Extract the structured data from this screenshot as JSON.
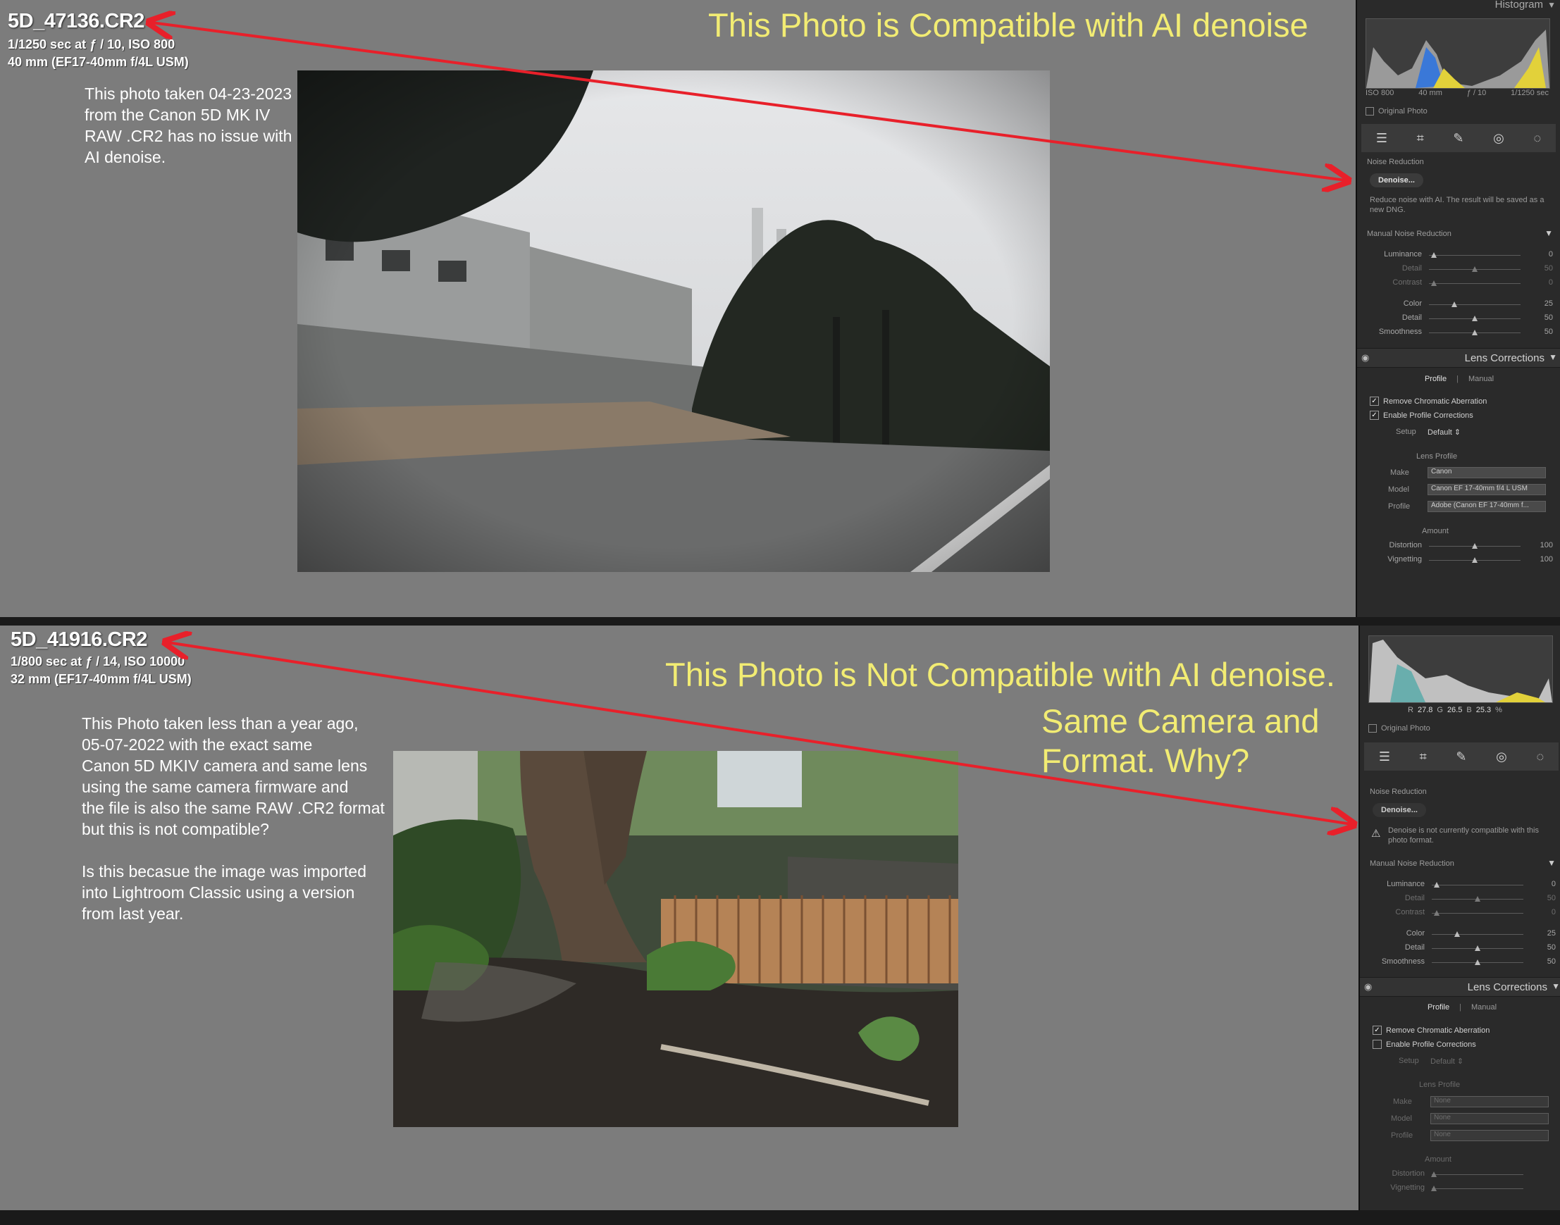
{
  "top": {
    "file_name": "5D_47136.CR2",
    "exposure": "1/1250 sec at ƒ / 10, ISO 800",
    "lens": "40 mm (EF17-40mm f/4L USM)",
    "note": "This photo taken 04-23-2023\nfrom the Canon 5D MK IV\nRAW .CR2 has no issue with\nAI denoise.",
    "headline": "This Photo is Compatible with AI denoise",
    "sidebar": {
      "histogram_label": "Histogram",
      "hist_info": [
        "ISO 800",
        "40 mm",
        "ƒ / 10",
        "1/1250 sec"
      ],
      "original_photo": "Original Photo",
      "noise_reduction": "Noise Reduction",
      "denoise_button": "Denoise...",
      "denoise_desc": "Reduce noise with AI. The result will be saved as a new DNG.",
      "manual_nr": "Manual Noise Reduction",
      "sliders": [
        {
          "label": "Luminance",
          "value": "0",
          "pos": 0.05,
          "dim": false
        },
        {
          "label": "Detail",
          "value": "50",
          "pos": 0.5,
          "dim": true
        },
        {
          "label": "Contrast",
          "value": "0",
          "pos": 0.05,
          "dim": true
        },
        {
          "label": "Color",
          "value": "25",
          "pos": 0.28,
          "dim": false
        },
        {
          "label": "Detail",
          "value": "50",
          "pos": 0.5,
          "dim": false
        },
        {
          "label": "Smoothness",
          "value": "50",
          "pos": 0.5,
          "dim": false
        }
      ],
      "lens_corrections": "Lens Corrections",
      "tab_profile": "Profile",
      "tab_manual": "Manual",
      "remove_ca": "Remove Chromatic Aberration",
      "enable_profile": "Enable Profile Corrections",
      "setup_label": "Setup",
      "setup_value": "Default",
      "lens_profile": "Lens Profile",
      "make_label": "Make",
      "make_value": "Canon",
      "model_label": "Model",
      "model_value": "Canon EF 17-40mm f/4 L USM",
      "profile_label": "Profile",
      "profile_value": "Adobe (Canon EF 17-40mm f...",
      "amount": "Amount",
      "distortion_label": "Distortion",
      "distortion_value": "100",
      "vignetting_label": "Vignetting",
      "vignetting_value": "100"
    }
  },
  "bottom": {
    "file_name": "5D_41916.CR2",
    "exposure": "1/800 sec at ƒ / 14, ISO 10000",
    "lens": "32 mm (EF17-40mm f/4L USM)",
    "note": "This Photo taken less than a year ago,\n05-07-2022 with the exact same\nCanon 5D MKIV camera and same lens\nusing the same camera firmware and\nthe file is also the same RAW .CR2 format\nbut this is not compatible?\n\nIs this becasue the image was imported\ninto Lightroom Classic using a version\nfrom last year.",
    "headline": "This Photo is Not Compatible with AI denoise.",
    "headline2": "Same Camera and\nFormat. Why?",
    "sidebar": {
      "rgb_r_label": "R",
      "rgb_r": "27.8",
      "rgb_g_label": "G",
      "rgb_g": "26.5",
      "rgb_b_label": "B",
      "rgb_b": "25.3",
      "rgb_unit": "%",
      "original_photo": "Original Photo",
      "noise_reduction": "Noise Reduction",
      "denoise_button": "Denoise...",
      "denoise_desc": "Denoise is not currently compatible with this photo format.",
      "manual_nr": "Manual Noise Reduction",
      "sliders": [
        {
          "label": "Luminance",
          "value": "0",
          "pos": 0.05,
          "dim": false
        },
        {
          "label": "Detail",
          "value": "50",
          "pos": 0.5,
          "dim": true
        },
        {
          "label": "Contrast",
          "value": "0",
          "pos": 0.05,
          "dim": true
        },
        {
          "label": "Color",
          "value": "25",
          "pos": 0.28,
          "dim": false
        },
        {
          "label": "Detail",
          "value": "50",
          "pos": 0.5,
          "dim": false
        },
        {
          "label": "Smoothness",
          "value": "50",
          "pos": 0.5,
          "dim": false
        }
      ],
      "lens_corrections": "Lens Corrections",
      "tab_profile": "Profile",
      "tab_manual": "Manual",
      "remove_ca": "Remove Chromatic Aberration",
      "enable_profile": "Enable Profile Corrections",
      "setup_label": "Setup",
      "setup_value": "Default",
      "lens_profile": "Lens Profile",
      "make_label": "Make",
      "make_value": "None",
      "model_label": "Model",
      "model_value": "None",
      "profile_label": "Profile",
      "profile_value": "None",
      "amount": "Amount",
      "distortion_label": "Distortion",
      "vignetting_label": "Vignetting"
    }
  },
  "colors": {
    "headline": "#f2ec73",
    "arrow": "#e8202a",
    "panel_bg": "#7c7c7c",
    "sidebar_bg": "#2a2a2a"
  }
}
